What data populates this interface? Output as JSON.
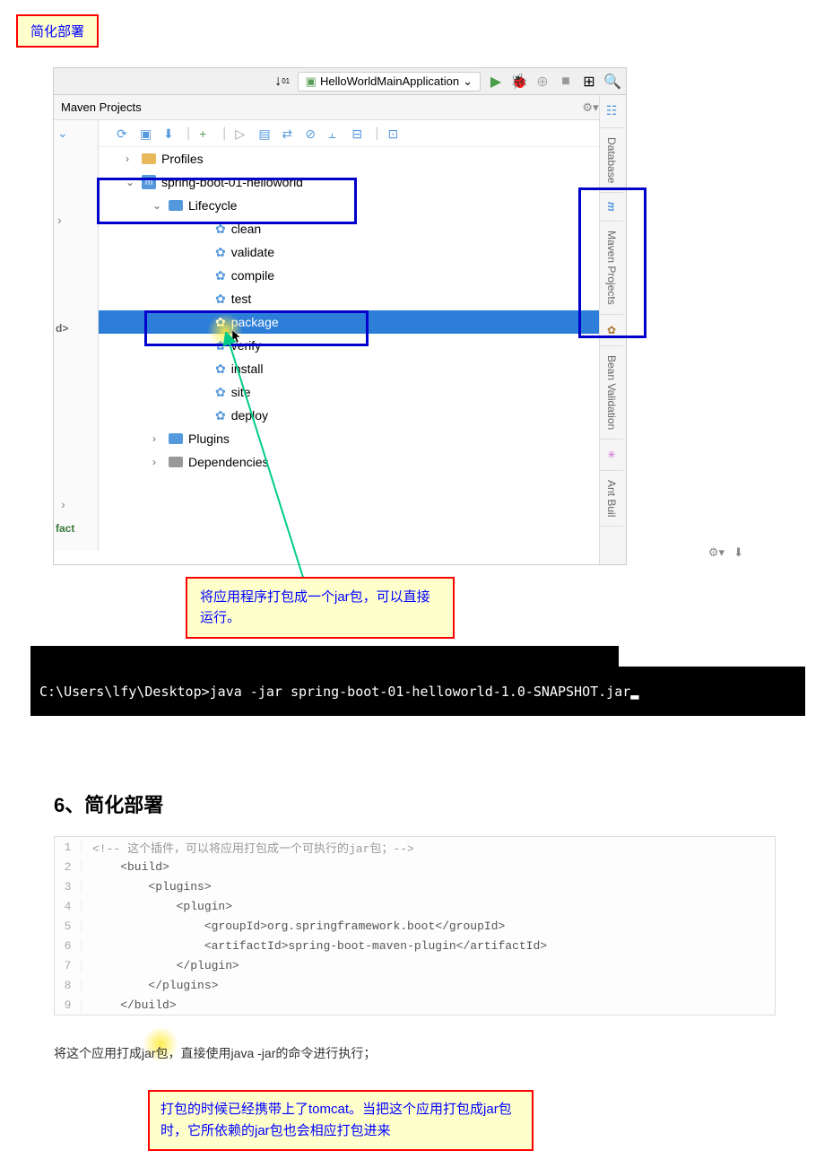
{
  "callouts": {
    "title": "简化部署",
    "note1": "将应用程序打包成一个jar包，可以直接运行。",
    "note2": "打包的时候已经携带上了tomcat。当把这个应用打包成jar包时，它所依赖的jar包也会相应打包进来"
  },
  "ide": {
    "runConfig": "HelloWorldMainApplication",
    "panelTitle": "Maven Projects",
    "leftLabel1": "d>",
    "leftLabel2": "fact",
    "tree": {
      "profiles": "Profiles",
      "project": "spring-boot-01-helloworld",
      "lifecycle": "Lifecycle",
      "goals": [
        "clean",
        "validate",
        "compile",
        "test",
        "package",
        "verify",
        "install",
        "site",
        "deploy"
      ],
      "plugins": "Plugins",
      "dependencies": "Dependencies"
    },
    "rightTabs": [
      "Database",
      "Maven Projects",
      "Bean Validation",
      "Ant Buil"
    ]
  },
  "terminal": {
    "prompt": "C:\\Users\\lfy\\Desktop>",
    "command": "java -jar spring-boot-01-helloworld-1.0-SNAPSHOT.jar"
  },
  "section": {
    "heading": "6、简化部署",
    "codeLines": [
      "<!-- 这个插件，可以将应用打包成一个可执行的jar包；-->",
      "    <build>",
      "        <plugins>",
      "            <plugin>",
      "                <groupId>org.springframework.boot</groupId>",
      "                <artifactId>spring-boot-maven-plugin</artifactId>",
      "            </plugin>",
      "        </plugins>",
      "    </build>"
    ],
    "paragraph": "将这个应用打成jar包，直接使用java -jar的命令进行执行；"
  }
}
